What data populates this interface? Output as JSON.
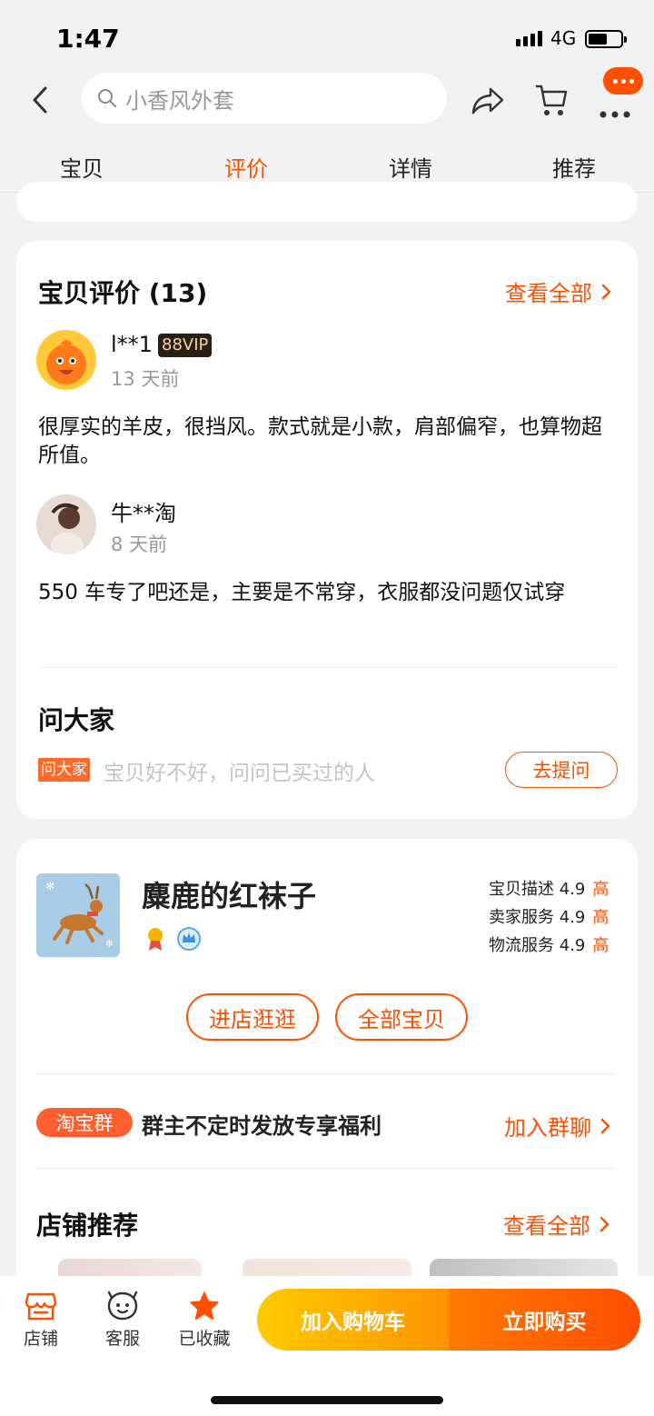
{
  "status_bar": {
    "time": "1:47",
    "network": "4G"
  },
  "nav": {
    "search_placeholder": "小香风外套"
  },
  "tabs": [
    {
      "label": "宝贝",
      "active": false
    },
    {
      "label": "评价",
      "active": true
    },
    {
      "label": "详情",
      "active": false
    },
    {
      "label": "推荐",
      "active": false
    }
  ],
  "reviews": {
    "title": "宝贝评价 (13)",
    "see_all": "查看全部",
    "items": [
      {
        "user": "l**1",
        "badge": "88VIP",
        "time": "13 天前",
        "text": "很厚实的羊皮，很挡风。款式就是小款，肩部偏窄，也算物超所值。"
      },
      {
        "user": "牛**淘",
        "time": "8 天前",
        "text": "550 车专了吧还是，主要是不常穿，衣服都没问题仅试穿"
      }
    ]
  },
  "ask": {
    "title": "问大家",
    "tag": "问大家",
    "placeholder": "宝贝好不好，问问已买过的人",
    "button": "去提问"
  },
  "shop": {
    "name": "麋鹿的红袜子",
    "scores": [
      {
        "label": "宝贝描述 4.9",
        "level": "高"
      },
      {
        "label": "卖家服务 4.9",
        "level": "高"
      },
      {
        "label": "物流服务 4.9",
        "level": "高"
      }
    ],
    "enter_button": "进店逛逛",
    "all_items_button": "全部宝贝",
    "group_tag": "淘宝群",
    "group_text": "群主不定时发放专享福利",
    "group_action": "加入群聊",
    "recommend_title": "店铺推荐",
    "recommend_see_all": "查看全部"
  },
  "bottom_bar": {
    "store": "店铺",
    "service": "客服",
    "favorited": "已收藏",
    "add_to_cart": "加入购物车",
    "buy_now": "立即购买"
  },
  "colors": {
    "accent": "#ff5000",
    "background": "#f2f2f2"
  }
}
